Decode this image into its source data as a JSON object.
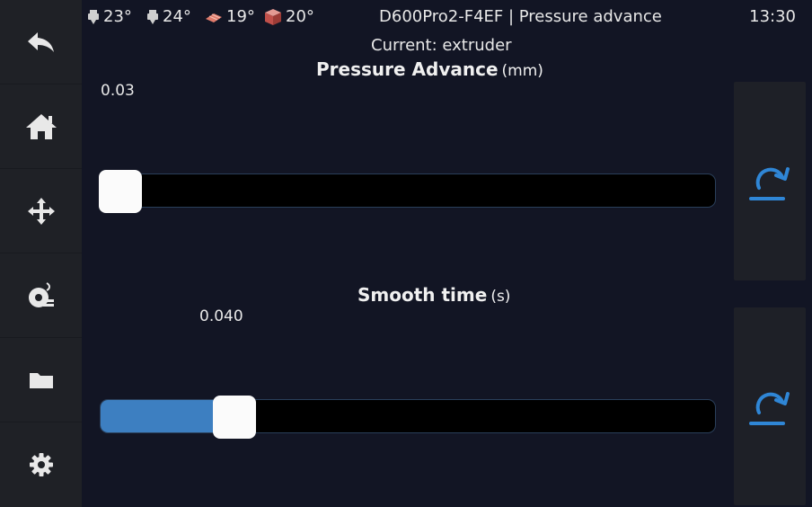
{
  "sidebar": {
    "items": [
      {
        "icon": "back-arrow-icon"
      },
      {
        "icon": "home-icon"
      },
      {
        "icon": "move-icon"
      },
      {
        "icon": "extrude-icon"
      },
      {
        "icon": "folder-icon"
      },
      {
        "icon": "gear-icon"
      }
    ]
  },
  "header": {
    "temps": [
      {
        "icon": "extruder-icon",
        "value": "23°"
      },
      {
        "icon": "extruder-icon",
        "value": "24°"
      },
      {
        "icon": "heated-bed-icon",
        "value": "19°"
      },
      {
        "icon": "chamber-icon",
        "value": "20°"
      }
    ],
    "title": "D600Pro2-F4EF | Pressure advance",
    "time": "13:30"
  },
  "current_label": "Current: extruder",
  "pressure_advance": {
    "label": "Pressure Advance",
    "unit": "(mm)",
    "value": "0.03",
    "fraction": 0.0
  },
  "smooth_time": {
    "label": "Smooth time",
    "unit": "(s)",
    "value": "0.040",
    "fraction": 0.2
  },
  "colors": {
    "accent": "#3d7fc1",
    "icon_blue": "#2f86d6",
    "background": "#121524",
    "sidebar": "#1f2126"
  },
  "icons": {
    "reset": "reset-icon"
  }
}
